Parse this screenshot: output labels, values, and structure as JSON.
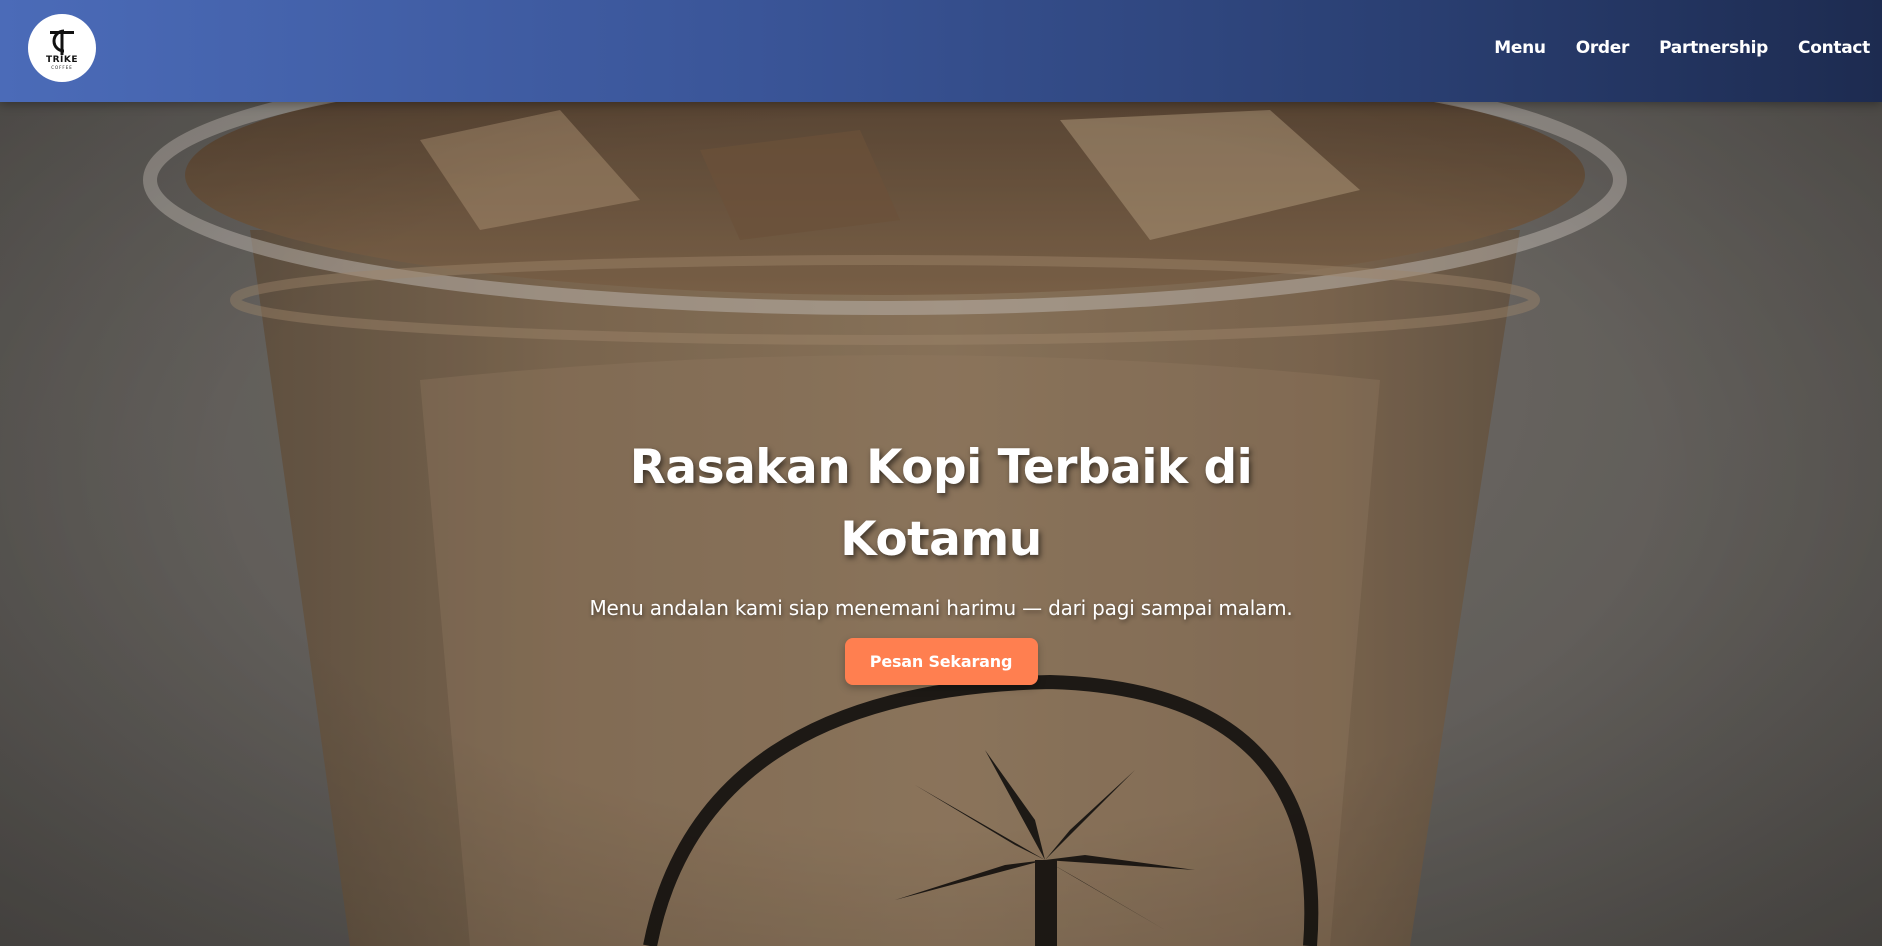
{
  "header": {
    "logo": {
      "text": "TRIKE",
      "subtext": "COFFEE",
      "icon": "tc-monogram-icon"
    },
    "nav": [
      {
        "label": "Menu"
      },
      {
        "label": "Order"
      },
      {
        "label": "Partnership"
      },
      {
        "label": "Contact"
      }
    ],
    "gradient_colors": [
      "#4b6bb8",
      "#1d2b50"
    ]
  },
  "hero": {
    "title": "Rasakan Kopi Terbaik di Kotamu",
    "subtitle": "Menu andalan kami siap menemani harimu — dari pagi sampai malam.",
    "cta_label": "Pesan Sekarang",
    "cta_color": "#ff7f50",
    "background_image": "iced-coffee-cup-photo"
  }
}
